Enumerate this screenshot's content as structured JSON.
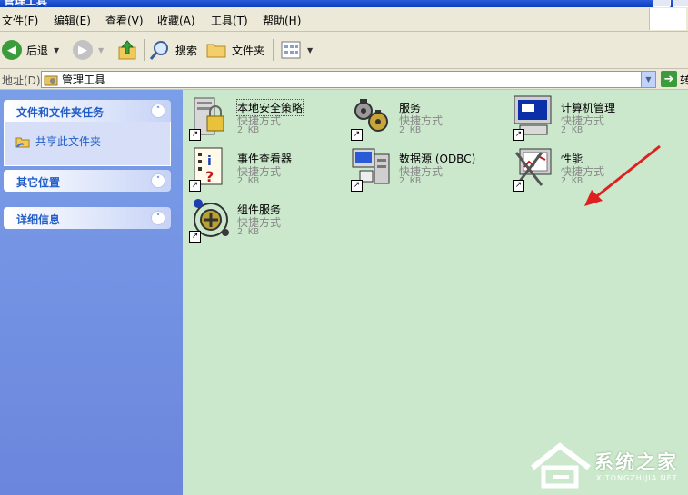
{
  "window": {
    "title": "管理工具"
  },
  "menu": [
    "文件(F)",
    "编辑(E)",
    "查看(V)",
    "收藏(A)",
    "工具(T)",
    "帮助(H)"
  ],
  "toolbar": {
    "back_label": "后退",
    "search_label": "搜索",
    "folders_label": "文件夹"
  },
  "address": {
    "label": "地址(D)",
    "value": "管理工具",
    "go_label": "转"
  },
  "taskpane": {
    "tasks_title": "文件和文件夹任务",
    "share_label": "共享此文件夹",
    "other_title": "其它位置",
    "details_title": "详细信息"
  },
  "items": [
    {
      "name": "本地安全策略",
      "type": "快捷方式",
      "size": "2 KB",
      "icon": "local-security-policy-icon"
    },
    {
      "name": "服务",
      "type": "快捷方式",
      "size": "2 KB",
      "icon": "services-icon"
    },
    {
      "name": "计算机管理",
      "type": "快捷方式",
      "size": "2 KB",
      "icon": "computer-management-icon"
    },
    {
      "name": "事件查看器",
      "type": "快捷方式",
      "size": "2 KB",
      "icon": "event-viewer-icon"
    },
    {
      "name": "数据源 (ODBC)",
      "type": "快捷方式",
      "size": "2 KB",
      "icon": "odbc-icon"
    },
    {
      "name": "性能",
      "type": "快捷方式",
      "size": "2 KB",
      "icon": "performance-icon"
    },
    {
      "name": "组件服务",
      "type": "快捷方式",
      "size": "2 KB",
      "icon": "component-services-icon"
    }
  ],
  "watermark": {
    "title": "系统之家",
    "url": "XITONGZHIJIA.NET"
  },
  "colors": {
    "content_bg": "#cce8cc",
    "taskpane_bg": "#7b9ee8",
    "link": "#215dc6",
    "annotation": "#e02020"
  }
}
